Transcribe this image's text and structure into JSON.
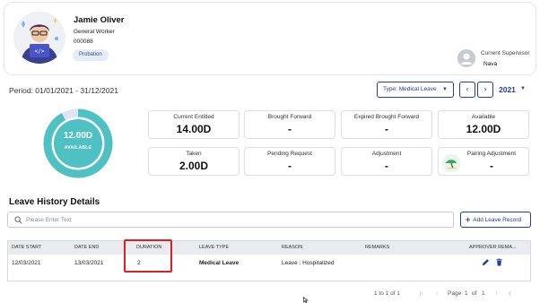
{
  "employee": {
    "name": "Jamie Oliver",
    "role": "General Worker",
    "id": "000088",
    "status_badge": "Probation",
    "avatar_icon": "developer-avatar-icon"
  },
  "supervisor": {
    "label": "Current Supervisor",
    "name": "Nava",
    "avatar_icon": "person-avatar-icon"
  },
  "period": "Period: 01/01/2021 - 31/12/2021",
  "filters": {
    "type_label": "Type: Medical Leave",
    "year": "2021"
  },
  "summary": {
    "available_value": "12.00D",
    "available_label": "AVAILABLE",
    "available_fraction": 0.92,
    "ring_color": "#4fc1c3"
  },
  "stats": [
    {
      "label": "Current Entitled",
      "value": "14.00D"
    },
    {
      "label": "Brought Forward",
      "value": "-"
    },
    {
      "label": "Expired Brought Forward",
      "value": "-"
    },
    {
      "label": "Available",
      "value": "12.00D"
    },
    {
      "label": "Taken",
      "value": "2.00D"
    },
    {
      "label": "Pending Request",
      "value": "-"
    },
    {
      "label": "Adjustment",
      "value": "-"
    },
    {
      "label": "Pairing Adjustment",
      "value": "-",
      "icon": "beach-umbrella-icon"
    }
  ],
  "history": {
    "title": "Leave History Details",
    "search_placeholder": "Please Enter Text",
    "add_button": "Add Leave Record",
    "columns": [
      "DATE START",
      "DATE END",
      "DURATION",
      "LEAVE TYPE",
      "REASON",
      "REMARKS",
      "APPROVER REMA..."
    ],
    "rows": [
      {
        "date_start": "12/03/2021",
        "date_end": "13/03/2021",
        "duration": "2",
        "leave_type": "Medical Leave",
        "reason": "Leave : Hospitalized",
        "remarks": ""
      }
    ]
  },
  "pagination": {
    "range": "1 to 1 of 1",
    "page_label": "Page",
    "current": "1",
    "of_label": "of",
    "total": "1"
  },
  "colors": {
    "accent": "#1f3fa0",
    "highlight": "#e02020",
    "ring": "#4fc1c3"
  }
}
